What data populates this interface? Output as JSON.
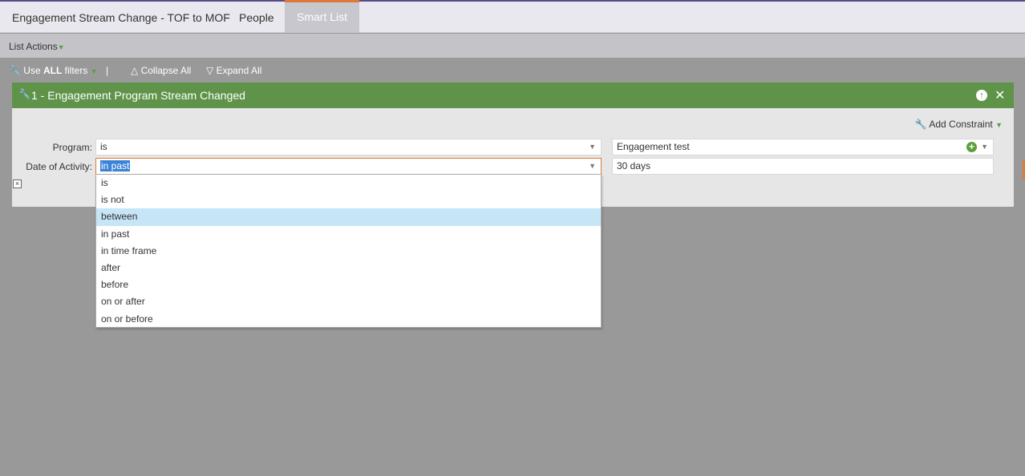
{
  "tabs": [
    {
      "label": "Engagement Stream Change - TOF to MOF"
    },
    {
      "label": "People"
    },
    {
      "label": "Smart List"
    }
  ],
  "list_actions": {
    "label": "List Actions"
  },
  "filter_bar": {
    "use_prefix": "Use ",
    "use_strong": "ALL",
    "use_suffix": " filters",
    "separator": "|",
    "collapse": "Collapse All",
    "expand": "Expand All"
  },
  "filter": {
    "title": "1 - Engagement Program Stream Changed",
    "add_constraint": "Add Constraint",
    "program_label": "Program:",
    "program_operator": "is",
    "program_value": "Engagement test",
    "date_label": "Date of Activity:",
    "date_operator": "in past",
    "date_value": "30 days"
  },
  "dropdown": {
    "options": [
      "is",
      "is not",
      "between",
      "in past",
      "in time frame",
      "after",
      "before",
      "on or after",
      "on or before"
    ],
    "highlighted": "between"
  },
  "colors": {
    "header_green": "#5e9349",
    "accent_orange": "#e07a3a",
    "highlight_blue": "#c6e5f7"
  }
}
